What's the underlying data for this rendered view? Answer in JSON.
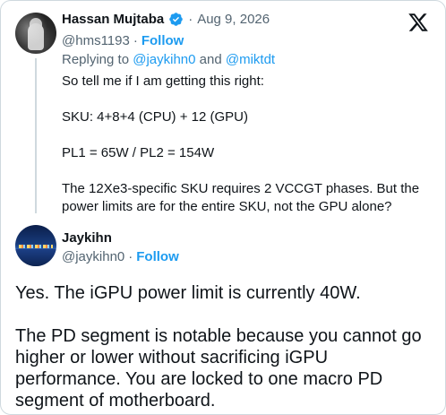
{
  "parent_tweet": {
    "author_name": "Hassan Mujtaba",
    "verified_icon": "verified-badge-icon",
    "separator": "·",
    "date": "Aug 9, 2026",
    "handle": "@hms1193",
    "handle_separator": "·",
    "follow_label": "Follow",
    "replying_prefix": "Replying to",
    "replying_to_1": "@jaykihn0",
    "replying_and": "and",
    "replying_to_2": "@miktdt",
    "body": [
      "So tell me if I am getting this right:",
      "SKU: 4+8+4 (CPU) + 12 (GPU)",
      "PL1 = 65W / PL2 = 154W",
      "The 12Xe3-specific SKU requires 2 VCCGT phases. But the power limits are for the entire SKU, not the GPU alone?"
    ]
  },
  "reply_tweet": {
    "author_name": "Jaykihn",
    "handle": "@jaykihn0",
    "handle_separator": "·",
    "follow_label": "Follow",
    "body": [
      "Yes. The iGPU power limit is currently 40W.",
      "The PD segment is notable because you cannot go higher or lower without sacrificing iGPU performance. You are locked to one macro PD segment of motherboard."
    ]
  },
  "brand": {
    "logo_icon": "x-logo-icon",
    "accent_color": "#1d9bf0",
    "text_color": "#0f1419",
    "secondary_text_color": "#536471"
  }
}
